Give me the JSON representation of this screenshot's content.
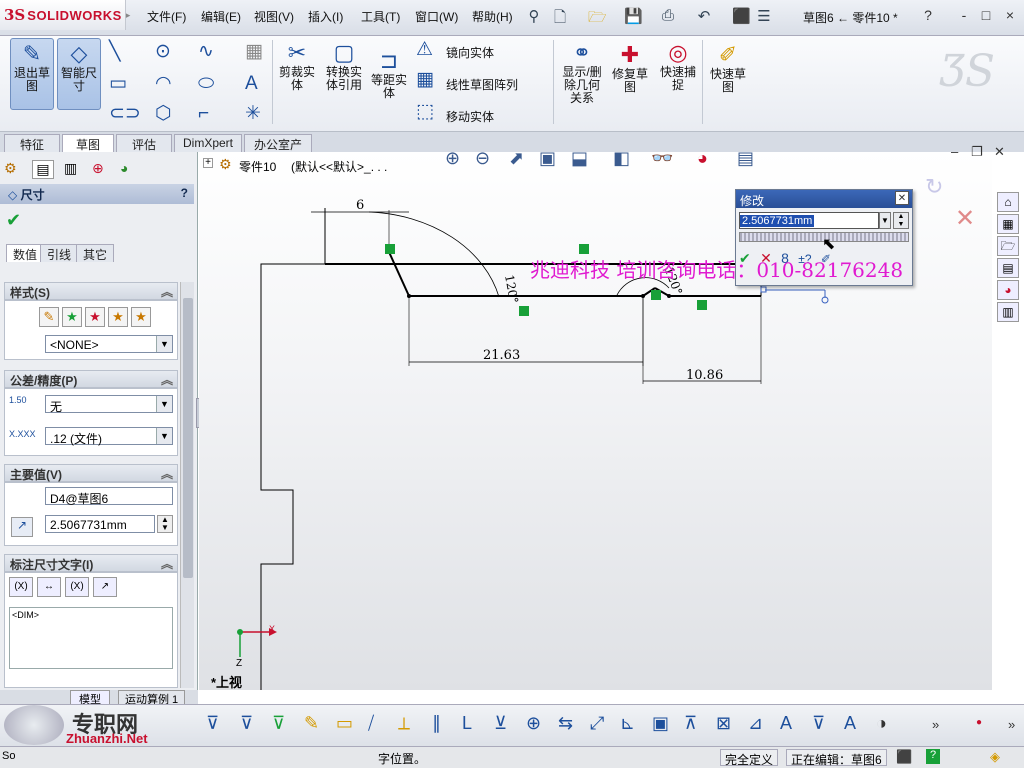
{
  "app": {
    "brand_prefix": "3S",
    "brand": "SOLIDWORKS"
  },
  "menu": [
    "文件(F)",
    "编辑(E)",
    "视图(V)",
    "插入(I)",
    "工具(T)",
    "窗口(W)",
    "帮助(H)"
  ],
  "doc_title": "草图6 ← 零件10 *",
  "title_buttons": [
    "?",
    "-",
    "□",
    "×"
  ],
  "ribbon": {
    "exit_sketch": "退出草图",
    "smart_dim": "智能尺寸",
    "trim": "剪裁实体",
    "convert": "转换实体引用",
    "offset": "等距实体",
    "mirror": "镜向实体",
    "linear_pattern": "线性草图阵列",
    "move": "移动实体",
    "display_relations": "显示/删除几何关系",
    "repair": "修复草图",
    "quick_snaps": "快速捕捉",
    "rapid_sketch": "快速草图"
  },
  "tabs": [
    "特征",
    "草图",
    "评估",
    "DimXpert",
    "办公室产品"
  ],
  "feature_path": {
    "part": "零件10",
    "config": "(默认<<默认>_. . ."
  },
  "panel": {
    "title": "尺寸",
    "help": "?",
    "subtabs": [
      "数值",
      "引线",
      "其它"
    ],
    "style_title": "样式(S)",
    "style_value": "<NONE>",
    "tolerance_title": "公差/精度(P)",
    "tolerance_value": "无",
    "tolerance_label": "1.50",
    "precision_value": ".12 (文件)",
    "precision_label": "X.XXX",
    "primary_title": "主要值(V)",
    "primary_name": "D4@草图6",
    "primary_value": "2.5067731mm",
    "dimtext_title": "标注尺寸文字(I)",
    "dimtext_value": "<DIM>"
  },
  "canvas": {
    "dims": [
      "6",
      "21.63",
      "10.86",
      "120°",
      "120°"
    ],
    "view_label": "*上视",
    "axis_x": "X",
    "axis_z": "Z"
  },
  "modify_dialog": {
    "title": "修改",
    "value": "2.5067731mm"
  },
  "watermark": "兆迪科技   培训咨询电话：010-82176248",
  "bottom_tabs": [
    "模型",
    "运动算例 1"
  ],
  "site_watermark": {
    "brand": "专职网",
    "url": "Zhuanzhi.Net"
  },
  "status": {
    "left": "So",
    "message": "字位置。",
    "defined": "完全定义",
    "editing": "正在编辑：草图6"
  },
  "colors": {
    "accent": "#1d4f9c",
    "brand": "#c8102e",
    "watermark": "#e01ad0",
    "relation_marker": "#18a038",
    "modify_header": "#2a4f97"
  }
}
